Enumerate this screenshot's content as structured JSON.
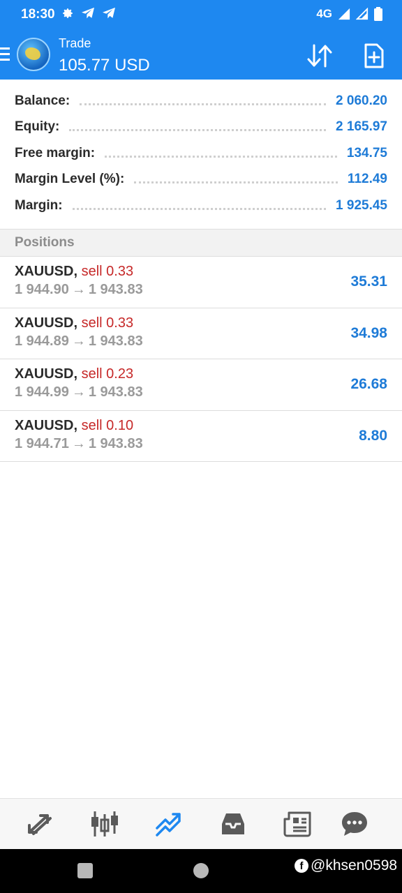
{
  "status_bar": {
    "time": "18:30",
    "network": "4G",
    "icons_left": [
      "settings-gear-icon",
      "telegram-icon",
      "telegram-icon"
    ],
    "icons_right": [
      "signal-icon",
      "signal-icon",
      "battery-icon"
    ]
  },
  "header": {
    "title": "Trade",
    "value": "105.77 USD",
    "actions": [
      "sort-icon",
      "new-order-icon"
    ]
  },
  "account": [
    {
      "label": "Balance:",
      "value": "2 060.20"
    },
    {
      "label": "Equity:",
      "value": "2 165.97"
    },
    {
      "label": "Free margin:",
      "value": "134.75"
    },
    {
      "label": "Margin Level (%):",
      "value": "112.49"
    },
    {
      "label": "Margin:",
      "value": "1 925.45"
    }
  ],
  "positions": {
    "title": "Positions",
    "items": [
      {
        "symbol": "XAUUSD,",
        "side": "sell 0.33",
        "open": "1 944.90",
        "arrow": "→",
        "current": "1 943.83",
        "profit": "35.31"
      },
      {
        "symbol": "XAUUSD,",
        "side": "sell 0.33",
        "open": "1 944.89",
        "arrow": "→",
        "current": "1 943.83",
        "profit": "34.98"
      },
      {
        "symbol": "XAUUSD,",
        "side": "sell 0.23",
        "open": "1 944.99",
        "arrow": "→",
        "current": "1 943.83",
        "profit": "26.68"
      },
      {
        "symbol": "XAUUSD,",
        "side": "sell 0.10",
        "open": "1 944.71",
        "arrow": "→",
        "current": "1 943.83",
        "profit": "8.80"
      }
    ]
  },
  "tabs": [
    {
      "icon": "quotes-icon",
      "active": false
    },
    {
      "icon": "chart-icon",
      "active": false
    },
    {
      "icon": "trade-icon",
      "active": true
    },
    {
      "icon": "history-icon",
      "active": false
    },
    {
      "icon": "news-icon",
      "active": false
    },
    {
      "icon": "messages-icon",
      "active": false
    }
  ],
  "watermark": "@khsen0598",
  "colors": {
    "header_bg": "#1e88f0",
    "value_blue": "#1e7bd7",
    "sell_red": "#c62828",
    "muted_gray": "#9a9a9a",
    "tab_active": "#1e88f0",
    "tab_inactive": "#5a5a5a"
  }
}
